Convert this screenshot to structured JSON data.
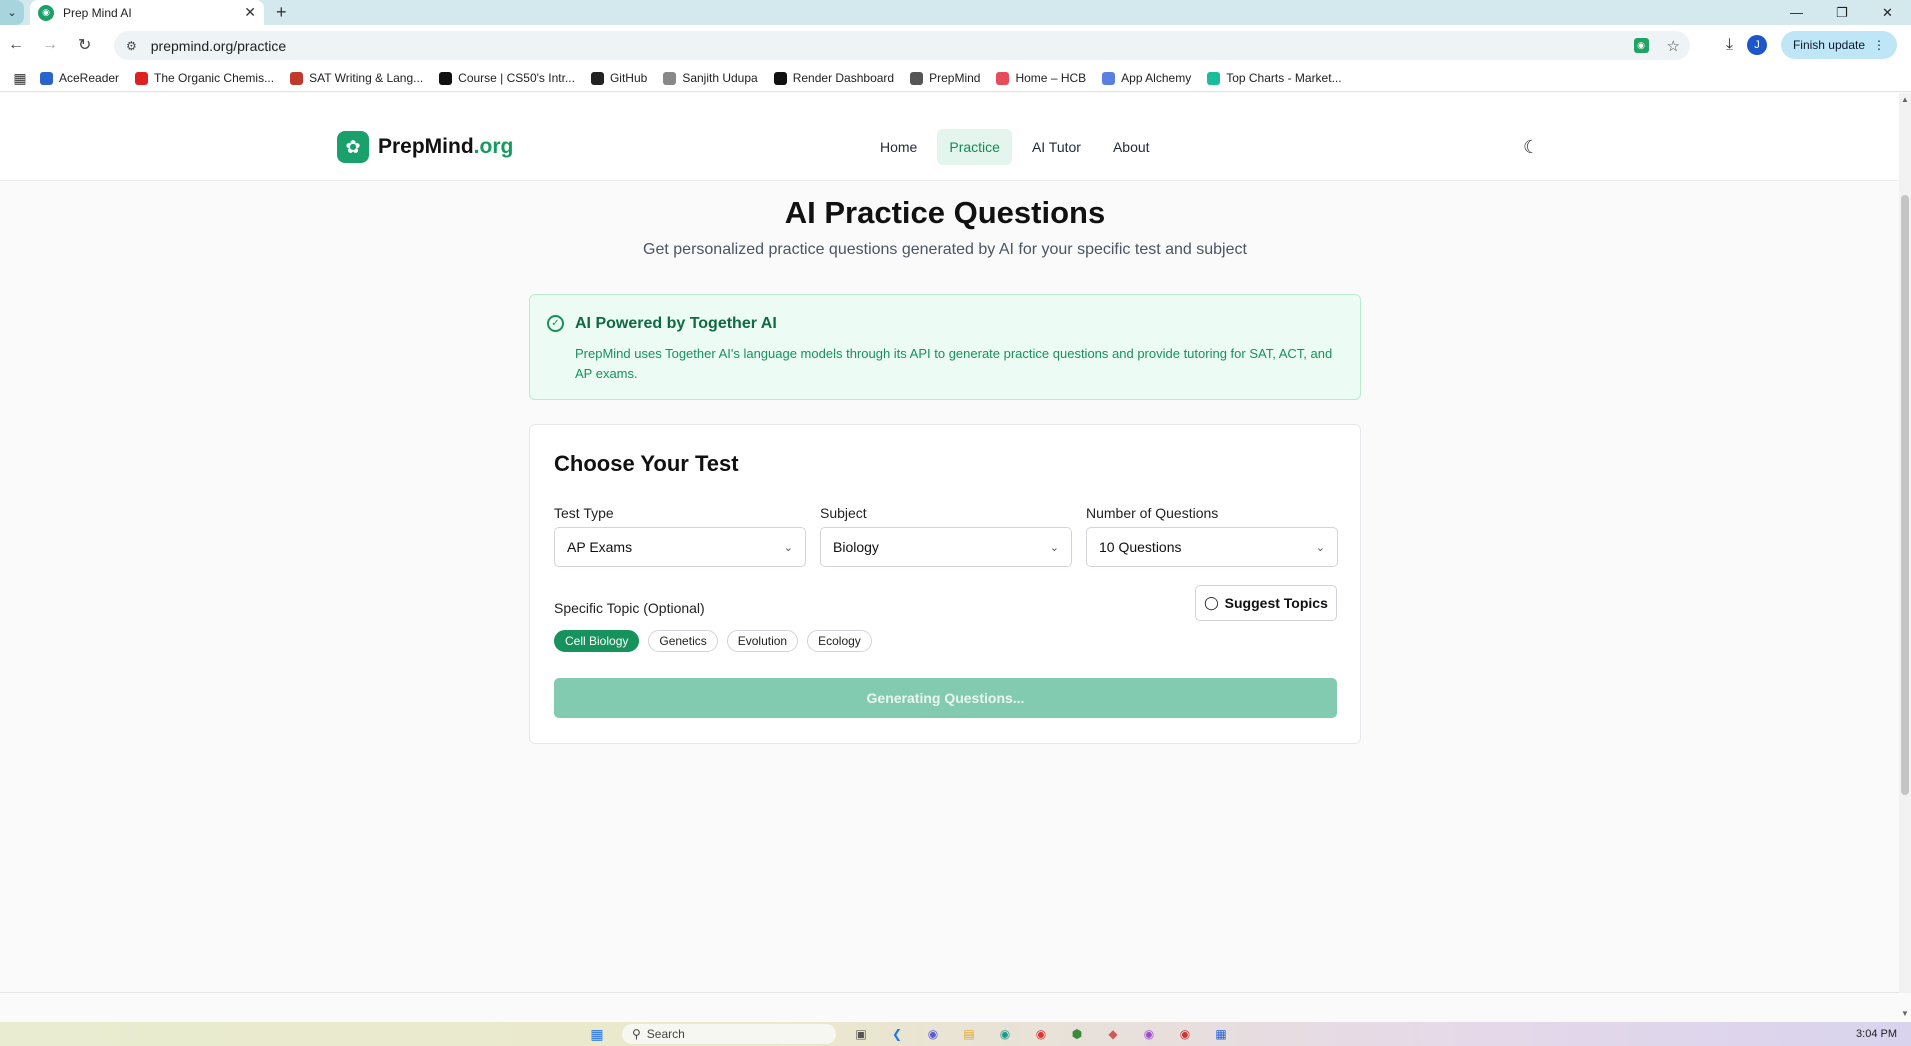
{
  "browser": {
    "tab_title": "Prep Mind AI",
    "url": "prepmind.org/practice",
    "finish_update_label": "Finish update",
    "profile_initial": "J",
    "bookmarks": [
      {
        "label": "AceReader",
        "color": "#2a63c9"
      },
      {
        "label": "The Organic Chemis...",
        "color": "#e02020"
      },
      {
        "label": "SAT Writing & Lang...",
        "color": "#c0392b"
      },
      {
        "label": "Course | CS50's Intr...",
        "color": "#111111"
      },
      {
        "label": "GitHub",
        "color": "#222222"
      },
      {
        "label": "Sanjith Udupa",
        "color": "#888888"
      },
      {
        "label": "Render Dashboard",
        "color": "#111111"
      },
      {
        "label": "PrepMind",
        "color": "#555555"
      },
      {
        "label": "Home – HCB",
        "color": "#e74c5a"
      },
      {
        "label": "App Alchemy",
        "color": "#5b7fe0"
      },
      {
        "label": "Top Charts - Market...",
        "color": "#1abc9c"
      }
    ]
  },
  "header": {
    "logo_text": "PrepMind",
    "logo_suffix": ".org",
    "nav": [
      {
        "label": "Home",
        "active": false
      },
      {
        "label": "Practice",
        "active": true
      },
      {
        "label": "AI Tutor",
        "active": false
      },
      {
        "label": "About",
        "active": false
      }
    ]
  },
  "main": {
    "title": "AI Practice Questions",
    "subtitle": "Get personalized practice questions generated by AI for your specific test and subject",
    "alert": {
      "title": "AI Powered by Together AI",
      "body": "PrepMind uses Together AI's language models through its API to generate practice questions and provide tutoring for SAT, ACT, and AP exams."
    },
    "card": {
      "title": "Choose Your Test",
      "test_type": {
        "label": "Test Type",
        "value": "AP Exams"
      },
      "subject": {
        "label": "Subject",
        "value": "Biology"
      },
      "num_questions": {
        "label": "Number of Questions",
        "value": "10 Questions"
      },
      "topic_label": "Specific Topic (Optional)",
      "suggest_label": "Suggest Topics",
      "topics": [
        {
          "label": "Cell Biology",
          "selected": true
        },
        {
          "label": "Genetics",
          "selected": false
        },
        {
          "label": "Evolution",
          "selected": false
        },
        {
          "label": "Ecology",
          "selected": false
        }
      ],
      "generate_label": "Generating Questions..."
    }
  },
  "taskbar": {
    "search_placeholder": "Search",
    "clock": "3:04 PM"
  },
  "colors": {
    "brand_green": "#16925c",
    "active_nav_bg": "#e3f5ec",
    "disabled_button": "#82cbb0"
  }
}
